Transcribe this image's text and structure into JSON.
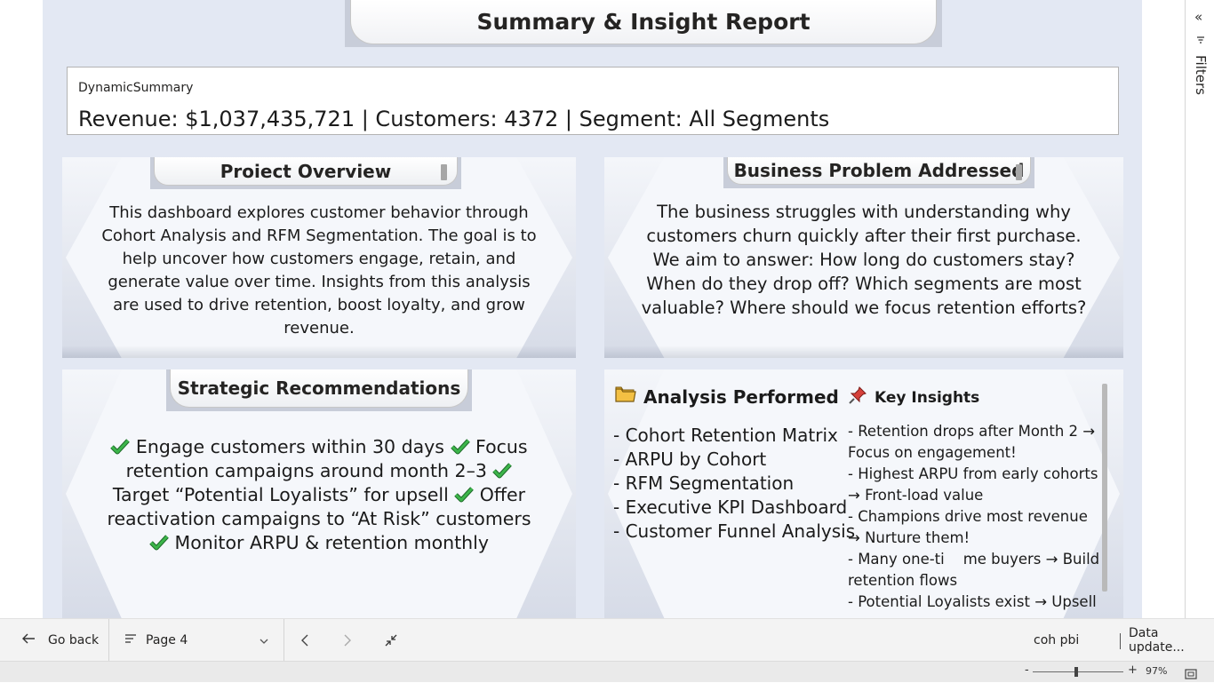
{
  "report": {
    "title": "Summary & Insight Report"
  },
  "summary": {
    "label": "DynamicSummary",
    "value": "Revenue: $1,037,435,721 | Customers: 4372 | Segment: All Segments"
  },
  "overview": {
    "title": "Proiect Overview",
    "body": "This dashboard explores customer behavior through Cohort Analysis and RFM Segmentation. The goal is to help uncover how customers engage, retain, and generate value over time. Insights from this analysis are used to drive retention, boost loyalty, and grow revenue."
  },
  "problem": {
    "title": "Business Problem Addressed",
    "body": "The business struggles with understanding why customers churn quickly after their first purchase. We aim to answer: How long do customers stay? When do they drop off? Which segments are most valuable? Where should we focus retention efforts?"
  },
  "recommendations": {
    "title": "Strategic Recommendations",
    "items": [
      "Engage customers within 30 days",
      "Focus retention campaigns around month 2–3",
      "Target “Potential Loyalists” for upsell",
      "Offer reactivation campaigns to “At Risk” customers",
      "Monitor ARPU & retention monthly"
    ]
  },
  "analysis": {
    "title": "Analysis Performed",
    "icon": "folder-icon",
    "items": [
      "- Cohort Retention Matrix",
      "- ARPU by Cohort",
      "- RFM Segmentation",
      "- Executive KPI Dashboard",
      "- Customer Funnel Analysis"
    ]
  },
  "insights": {
    "title": "Key Insights",
    "icon": "pushpin-icon",
    "items": [
      "- Retention drops after Month 2 → Focus on engagement!",
      "- Highest ARPU from early cohorts → Front-load value",
      "- Champions drive most revenue → Nurture them!",
      "- Many one-ti    me buyers → Build retention flows",
      "- Potential Loyalists exist → Upsell"
    ]
  },
  "filters_pane": {
    "label": "Filters",
    "collapse_icon": "double-chevron-left-icon",
    "filter_icon": "filter-icon"
  },
  "bottom_bar": {
    "back_label": "Go back",
    "page_label": "Page 4",
    "workspace_label": "coh pbi",
    "data_update_label": "Data update..."
  },
  "status_bar": {
    "zoom_minus": "-",
    "zoom_plus": "+",
    "zoom_level": "97%"
  },
  "colors": {
    "canvas_bg": "#e3e8f3",
    "check_green": "#2ea043",
    "folder_yellow": "#f3c043",
    "pin_red": "#d6403a"
  }
}
